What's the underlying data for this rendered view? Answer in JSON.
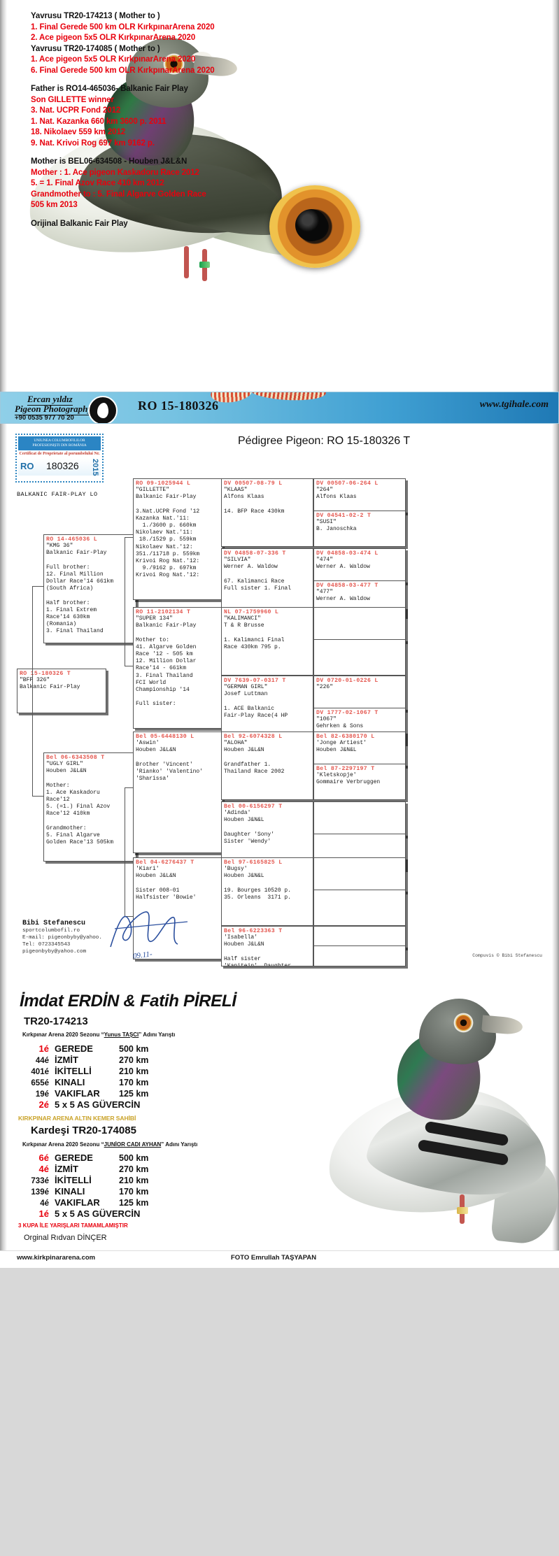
{
  "notes": {
    "lines": [
      {
        "text": "Yavrusu TR20-174213  ( Mother to )",
        "red": false
      },
      {
        "text": "1. Final Gerede 500 km OLR KırkpınarArena 2020",
        "red": true
      },
      {
        "text": "2. Ace pigeon 5x5 OLR KırkpınarArena 2020",
        "red": true
      },
      {
        "text": "Yavrusu  TR20-174085 ( Mother to )",
        "red": false
      },
      {
        "text": "1. Ace pigeon 5x5 OLR KırkpınarArena 2020",
        "red": true
      },
      {
        "text": "6. Final Gerede 500 km OLR KırkpınarArena 2020",
        "red": true
      },
      {
        "text": "",
        "red": false
      },
      {
        "text": "Father is RO14-465036- Balkanic Fair Play",
        "red": false
      },
      {
        "text": "Son GILLETTE winner",
        "red": true
      },
      {
        "text": "3.   Nat. UCPR Fond 2012",
        "red": true
      },
      {
        "text": "1.   Nat. Kazanka 660 km 3600 p. 2011",
        "red": true
      },
      {
        "text": "18. Nikolaev 559 km   2012",
        "red": true
      },
      {
        "text": "9.   Nat. Krivoi Rog 697 km  9162 p.",
        "red": true
      },
      {
        "text": "",
        "red": false
      },
      {
        "text": "Mother is  BEL06-634508 - Houben J&L&N",
        "red": false
      },
      {
        "text": "Mother : 1.  Ace pigeon Kaskadoru Race 2012",
        "red": true
      },
      {
        "text": "5. = 1. Final Azov Race 410 km 2012",
        "red": true
      },
      {
        "text": "Grandmother to : 5. Final Algarve Golden Race",
        "red": true
      },
      {
        "text": "505 km 2013",
        "red": true
      },
      {
        "text": "",
        "red": false
      },
      {
        "text": "Orijinal Balkanic Fair Play",
        "red": false
      }
    ]
  },
  "banner": {
    "photographer": "Ercan yıldız",
    "studio": "Pigeon Photography",
    "phone": "+90 0535 977 70 20",
    "ring_id": "RO 15-180326",
    "website": "www.tgihale.com"
  },
  "pedigree": {
    "title": "Pédigree Pigeon: RO  15-180326 T",
    "certificate": {
      "org_line1": "UNIUNEA COLUMBOFILILOR",
      "org_line2": "PROFESIONIȘTI DIN ROMÂNIA",
      "caption": "Certificat de Proprietate al porumbelului Nr.",
      "country": "RO",
      "number": "180326",
      "year": "2015"
    },
    "loft_label": "BALKANIC FAIR-PLAY LO",
    "subject": {
      "rid": "RO  15-180326 T",
      "lines": [
        "\"BFP 326\"",
        "Balkanic Fair-Play"
      ]
    },
    "gen1": [
      {
        "rid": "RO  14-465036 L",
        "lines": [
          "\"KMG 36\"",
          "Balkanic Fair-Play",
          "",
          "Full brother:",
          "12. Final Million",
          "Dollar Race'14 661km",
          "(South Africa)",
          "",
          "Half brother:",
          "1. Final Extrem",
          "Race'14 630km",
          "(Romania)",
          "3. Final Thailand"
        ]
      },
      {
        "rid": "Bel  06-6343508 T",
        "lines": [
          "\"UGLY GIRL\"",
          "Houben J&L&N",
          "",
          "Mother:",
          "1. Ace Kaskadoru",
          "Race'12",
          "5. (=1.) Final Azov",
          "Race'12 410km",
          "",
          "Grandmother:",
          "5. Final Algarve",
          "Golden Race'13 505km"
        ]
      }
    ],
    "gen2": [
      {
        "rid": "RO  09-1025944 L",
        "lines": [
          "\"GILLETTE\"",
          "Balkanic Fair-Play",
          "",
          "3.Nat.UCPR Fond '12",
          "Kazanka Nat.'11:",
          "  1./3600 p. 660km",
          "Nikolaev Nat.'11:",
          " 18./1529 p. 559km",
          "Nikolaev Nat.'12:",
          "351./11718 p. 559km",
          "Krivoi Rog Nat.'12:",
          "  9./9162 p. 697km",
          "Krivoi Rog Nat.'12:"
        ]
      },
      {
        "rid": "RO  11-2102134 T",
        "lines": [
          "\"SUPER 134\"",
          "Balkanic Fair-Play",
          "",
          "Mother to:",
          "41. Algarve Golden",
          "Race '12 - 505 km",
          "12. Million Dollar",
          "Race'14 - 661km",
          "3. Final Thailand",
          "FCI World",
          "Championship '14",
          "",
          "Full sister:"
        ]
      },
      {
        "rid": "Bel  05-6448130 L",
        "lines": [
          "'Aswin'",
          "Houben J&L&N",
          "",
          "Brother 'Vincent'",
          "'Rianko' 'Valentino'",
          "'Sharissa'"
        ]
      },
      {
        "rid": "Bel  04-6276437 T",
        "lines": [
          "'Kiari'",
          "Houben J&L&N",
          "",
          "Sister 008-01",
          "Halfsister 'Bowie'"
        ]
      }
    ],
    "gen3": [
      {
        "rid": "DV  00507-08-79 L",
        "lines": [
          "\"KLAAS\"",
          "Alfons Klaas",
          "",
          "14. BFP Race 430km"
        ]
      },
      {
        "rid": "DV  04858-07-336 T",
        "lines": [
          "\"SILVIA\"",
          "Werner A. Waldow",
          "",
          "67. Kalimanci Race",
          "Full sister 1. Final"
        ]
      },
      {
        "rid": "NL  07-1759960 L",
        "lines": [
          "\"KALIMANCI\"",
          "T & R Brusse",
          "",
          "1. Kalimanci Final",
          "Race 430km 795 p."
        ]
      },
      {
        "rid": "DV  7639-07-0317 T",
        "lines": [
          "\"GERMAN GIRL\"",
          "Josef Luttman",
          "",
          "1. ACE Balkanic",
          "Fair-Play Race(4 HP"
        ]
      },
      {
        "rid": "Bel  92-6074328 L",
        "lines": [
          "\"ALOHA\"",
          "Houben J&L&N",
          "",
          "Grandfather 1.",
          "Thailand Race 2002"
        ]
      },
      {
        "rid": "Bel  00-6156297 T",
        "lines": [
          "'Adinda'",
          "Houben J&N&L",
          "",
          "Daughter 'Sony'",
          "Sister 'Wendy'"
        ]
      },
      {
        "rid": "Bel  97-6165825 L",
        "lines": [
          "'Bugsy'",
          "Houben J&N&L",
          "",
          "19. Bourges 10520 p.",
          "35. Orleans  3171 p."
        ]
      },
      {
        "rid": "Bel  96-6223363 T",
        "lines": [
          "'Isabella'",
          "Houben J&L&N",
          "",
          "Half sister",
          "'Kapitein'. Daughter"
        ]
      }
    ],
    "gen4": [
      {
        "rid": "DV  00507-06-264 L",
        "lines": [
          "\"264\"",
          "Alfons Klaas"
        ]
      },
      {
        "rid": "DV  04541-02-2 T",
        "lines": [
          "\"SUSI\"",
          "B. Janoschka"
        ]
      },
      {
        "rid": "DV  04858-03-474 L",
        "lines": [
          "\"474\"",
          "Werner A. Waldow"
        ]
      },
      {
        "rid": "DV  04858-03-477 T",
        "lines": [
          "\"477\"",
          "Werner A. Waldow"
        ]
      },
      {
        "rid": "",
        "lines": []
      },
      {
        "rid": "",
        "lines": []
      },
      {
        "rid": "DV  0720-01-0226 L",
        "lines": [
          "\"226\""
        ]
      },
      {
        "rid": "DV  1777-02-1067 T",
        "lines": [
          "\"1067\"",
          "Gehrken & Sons"
        ]
      },
      {
        "rid": "Bel  82-6380170 L",
        "lines": [
          "'Jonge Artiest'",
          "Houben J&N&L"
        ]
      },
      {
        "rid": "Bel  87-2297197 T",
        "lines": [
          "'Kletskopje'",
          "Gommaire Verbruggen"
        ]
      },
      {
        "rid": "",
        "lines": []
      },
      {
        "rid": "",
        "lines": []
      },
      {
        "rid": "",
        "lines": []
      },
      {
        "rid": "",
        "lines": []
      },
      {
        "rid": "",
        "lines": []
      },
      {
        "rid": "",
        "lines": []
      }
    ],
    "footer": {
      "name": "Bibi Stefanescu",
      "lines": [
        "sportcolumbofil.ro",
        "E-mail: pigeonbyby@yahoo.",
        "Tel: 0723345543",
        "pigeonbyby@yahoo.com"
      ],
      "handwritten_date": "09.11-",
      "credit": "Compuvis © Bibi Stefanescu"
    }
  },
  "results": {
    "owners": "İmdat ERDİN & Fatih PİRELİ",
    "bird1": {
      "ring": "TR20-174213",
      "season_note_pre": "Kırkpınar Arena 2020 Sezonu “",
      "season_note_name": "Yunus TAŞCI",
      "season_note_post": "” Adını Yarıştı",
      "rows": [
        {
          "pos": "1é",
          "place": "GEREDE",
          "km": "500 km",
          "red": true
        },
        {
          "pos": "44é",
          "place": "İZMİT",
          "km": "270 km",
          "red": false
        },
        {
          "pos": "401é",
          "place": "İKİTELLİ",
          "km": "210 km",
          "red": false
        },
        {
          "pos": "655é",
          "place": "KINALI",
          "km": "170 km",
          "red": false
        },
        {
          "pos": "19é",
          "place": "VAKIFLAR",
          "km": "125 km",
          "red": false
        },
        {
          "pos": "2é",
          "place": "5 x 5 AS GÜVERCİN",
          "km": "",
          "red": true
        }
      ],
      "gold_badge": "KIRKPINAR ARENA ALTIN KEMER SAHİBİ"
    },
    "bird2": {
      "label": "Kardeşi TR20-174085",
      "season_note_pre": "Kırkpınar Arena 2020 Sezonu “",
      "season_note_name": "JUNİOR CADI AYHAN",
      "season_note_post": "” Adını Yarıştı",
      "rows": [
        {
          "pos": "6é",
          "place": "GEREDE",
          "km": "500 km",
          "red": true
        },
        {
          "pos": "4é",
          "place": "İZMİT",
          "km": "270 km",
          "red": true
        },
        {
          "pos": "733é",
          "place": "İKİTELLİ",
          "km": "210 km",
          "red": false
        },
        {
          "pos": "139é",
          "place": "KINALI",
          "km": "170 km",
          "red": false
        },
        {
          "pos": "4é",
          "place": "VAKIFLAR",
          "km": "125 km",
          "red": false
        },
        {
          "pos": "1é",
          "place": "5 x 5 AS GÜVERCİN",
          "km": "",
          "red": true
        }
      ]
    },
    "trophy_note": "3 KUPA İLE YARIŞLARI TAMAMLAMIŞTIR",
    "origin": "Orginal Rıdvan DİNÇER"
  },
  "footer": {
    "site": "www.kirkpinararena.com",
    "photo_credit": "FOTO Emrullah TAŞYAPAN"
  }
}
